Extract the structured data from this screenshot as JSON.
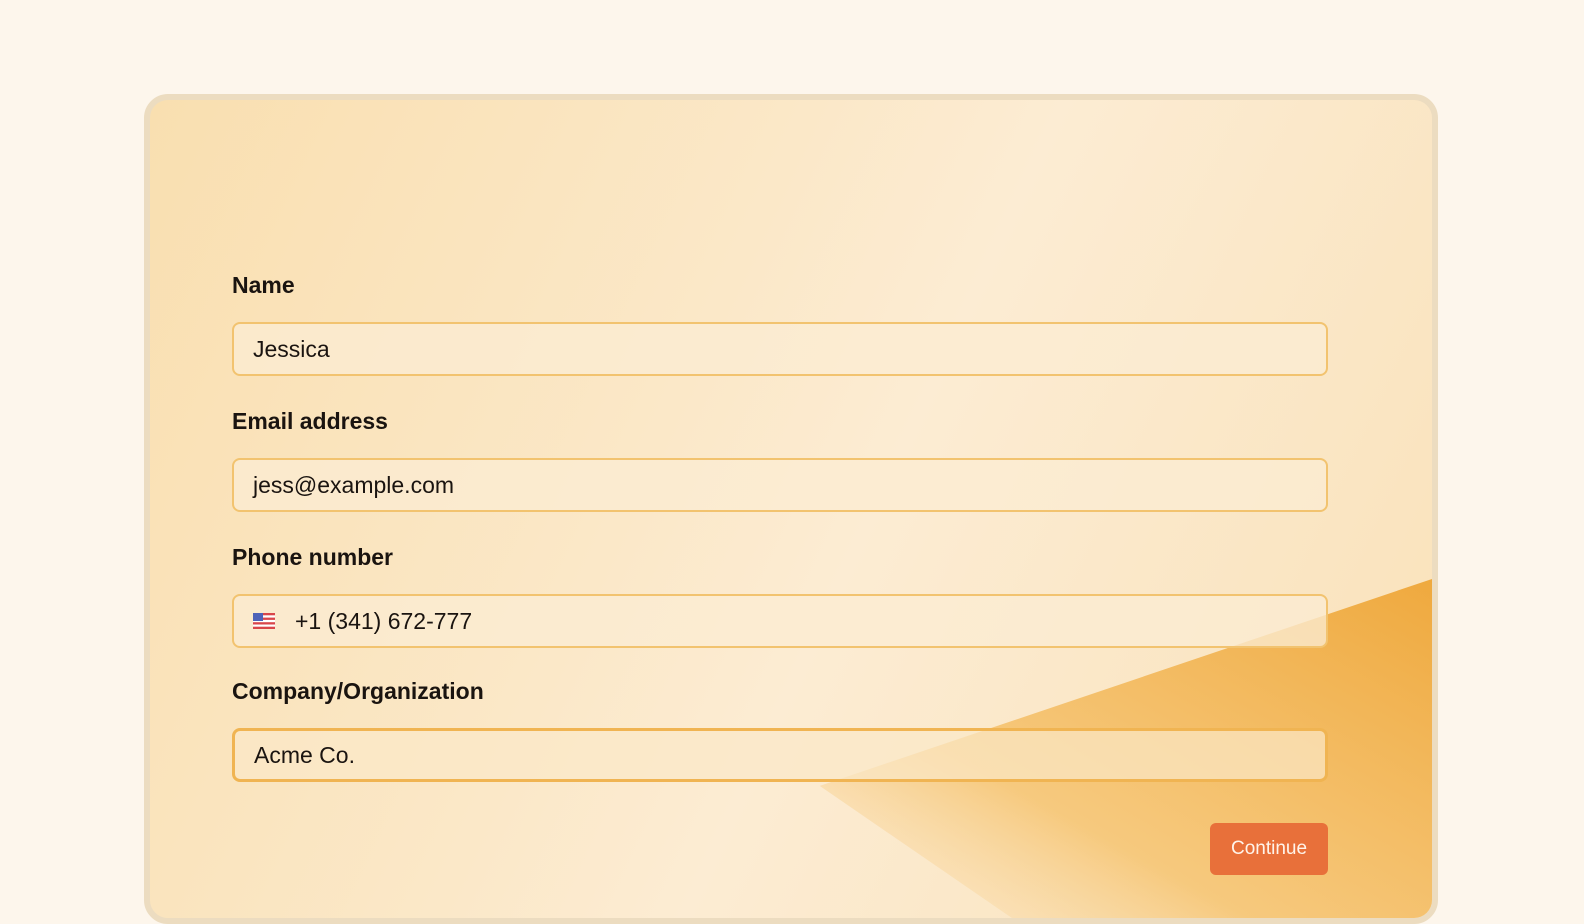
{
  "form": {
    "name": {
      "label": "Name",
      "value": "Jessica"
    },
    "email": {
      "label": "Email address",
      "value": "jess@example.com"
    },
    "phone": {
      "label": "Phone number",
      "value": "+1 (341) 672-777",
      "flag_icon": "us-flag-icon"
    },
    "company": {
      "label": "Company/Organization",
      "value": "Acme Co."
    },
    "continue_label": "Continue"
  },
  "colors": {
    "accent": "#e8703a",
    "input_border": "#f2c36f",
    "page_bg": "#fdf6ec",
    "card_border": "#ecdcc0"
  }
}
